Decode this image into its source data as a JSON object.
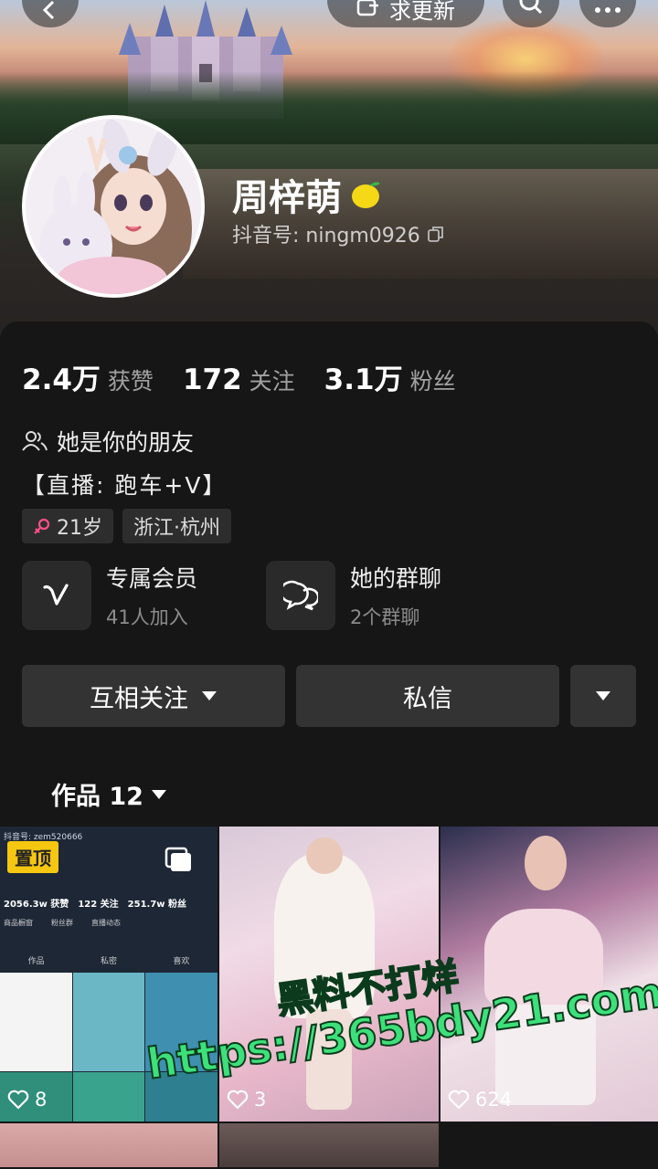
{
  "header": {
    "update_label": "求更新"
  },
  "profile": {
    "nickname": "周梓萌",
    "account_label": "抖音号: ningm0926",
    "avatar_signature": "周梓萌"
  },
  "stats": [
    {
      "num": "2.4万",
      "label": "获赞"
    },
    {
      "num": "172",
      "label": "关注"
    },
    {
      "num": "3.1万",
      "label": "粉丝"
    }
  ],
  "relation": "她是你的朋友",
  "bio": "【直播: 跑车+V】",
  "tags": {
    "age": "21岁",
    "location": "浙江·杭州"
  },
  "features": [
    {
      "title": "专属会员",
      "sub": "41人加入"
    },
    {
      "title": "她的群聊",
      "sub": "2个群聊"
    }
  ],
  "actions": {
    "follow": "互相关注",
    "message": "私信"
  },
  "works": {
    "tab_label": "作品 12"
  },
  "grid": {
    "pin_label": "置顶",
    "items": [
      {
        "likes": "8"
      },
      {
        "likes": "3"
      },
      {
        "likes": "624"
      }
    ],
    "mini": {
      "account": "抖音号: zem520666",
      "stats": [
        "2056.3w 获赞",
        "122 关注",
        "251.7w 粉丝"
      ],
      "menu": [
        "商品橱窗",
        "粉丝群",
        "直播动态"
      ],
      "tabs": [
        "作品",
        "私密",
        "喜欢"
      ]
    }
  },
  "watermark": {
    "line1": "黑料不打烊",
    "line2": "https://365bdy21.com"
  }
}
